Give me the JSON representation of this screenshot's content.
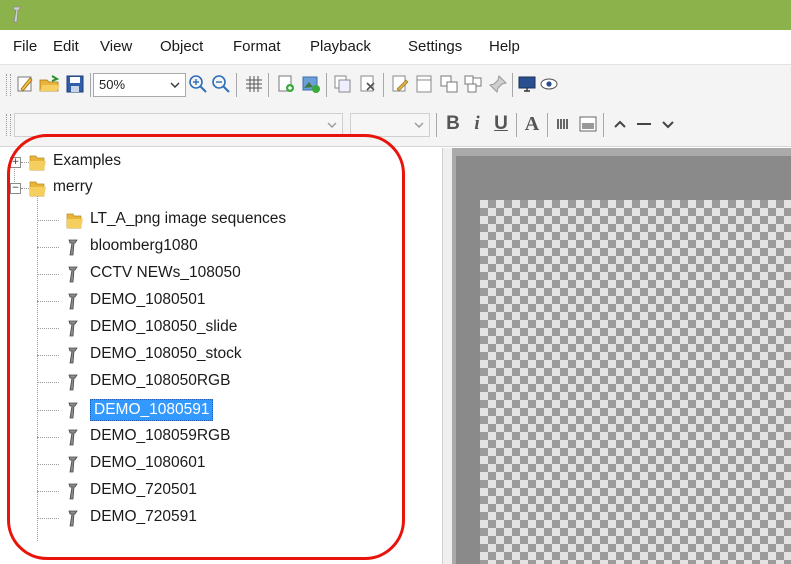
{
  "menu": {
    "items": [
      "File",
      "Edit",
      "View",
      "Object",
      "Format",
      "Playback",
      "Settings",
      "Help"
    ]
  },
  "toolbar": {
    "zoom_value": "50%",
    "font_family_value": "",
    "font_size_value": "",
    "bold_label": "B",
    "italic_label": "i",
    "underline_label": "U",
    "font_color_label": "A"
  },
  "tree": {
    "root_examples": "Examples",
    "root_merry": "merry",
    "children": [
      {
        "label": "LT_A_png  image sequences",
        "type": "folder"
      },
      {
        "label": "bloomberg1080",
        "type": "file"
      },
      {
        "label": "CCTV NEWs_108050",
        "type": "file"
      },
      {
        "label": "DEMO_1080501",
        "type": "file"
      },
      {
        "label": "DEMO_108050_slide",
        "type": "file"
      },
      {
        "label": "DEMO_108050_stock",
        "type": "file"
      },
      {
        "label": "DEMO_108050RGB",
        "type": "file"
      },
      {
        "label": "DEMO_1080591",
        "type": "file",
        "selected": true
      },
      {
        "label": "DEMO_108059RGB",
        "type": "file"
      },
      {
        "label": "DEMO_1080601",
        "type": "file"
      },
      {
        "label": "DEMO_720501",
        "type": "file"
      },
      {
        "label": "DEMO_720591",
        "type": "file"
      }
    ]
  },
  "colors": {
    "titlebar": "#8cb34b",
    "selection": "#3399ff",
    "annotation_ring": "#e8140c",
    "folder": "#e8b53a"
  },
  "icons": [
    "app-icon",
    "new-icon",
    "open-icon",
    "save-icon",
    "zoom-in-icon",
    "zoom-out-icon",
    "grid-icon",
    "add-page-icon",
    "add-image-icon",
    "copy-icon",
    "delete-icon",
    "edit-icon",
    "page-icon",
    "clone-icon",
    "group-icon",
    "pin-icon",
    "monitor-icon",
    "eye-icon",
    "folder-icon",
    "clip-file-icon"
  ]
}
